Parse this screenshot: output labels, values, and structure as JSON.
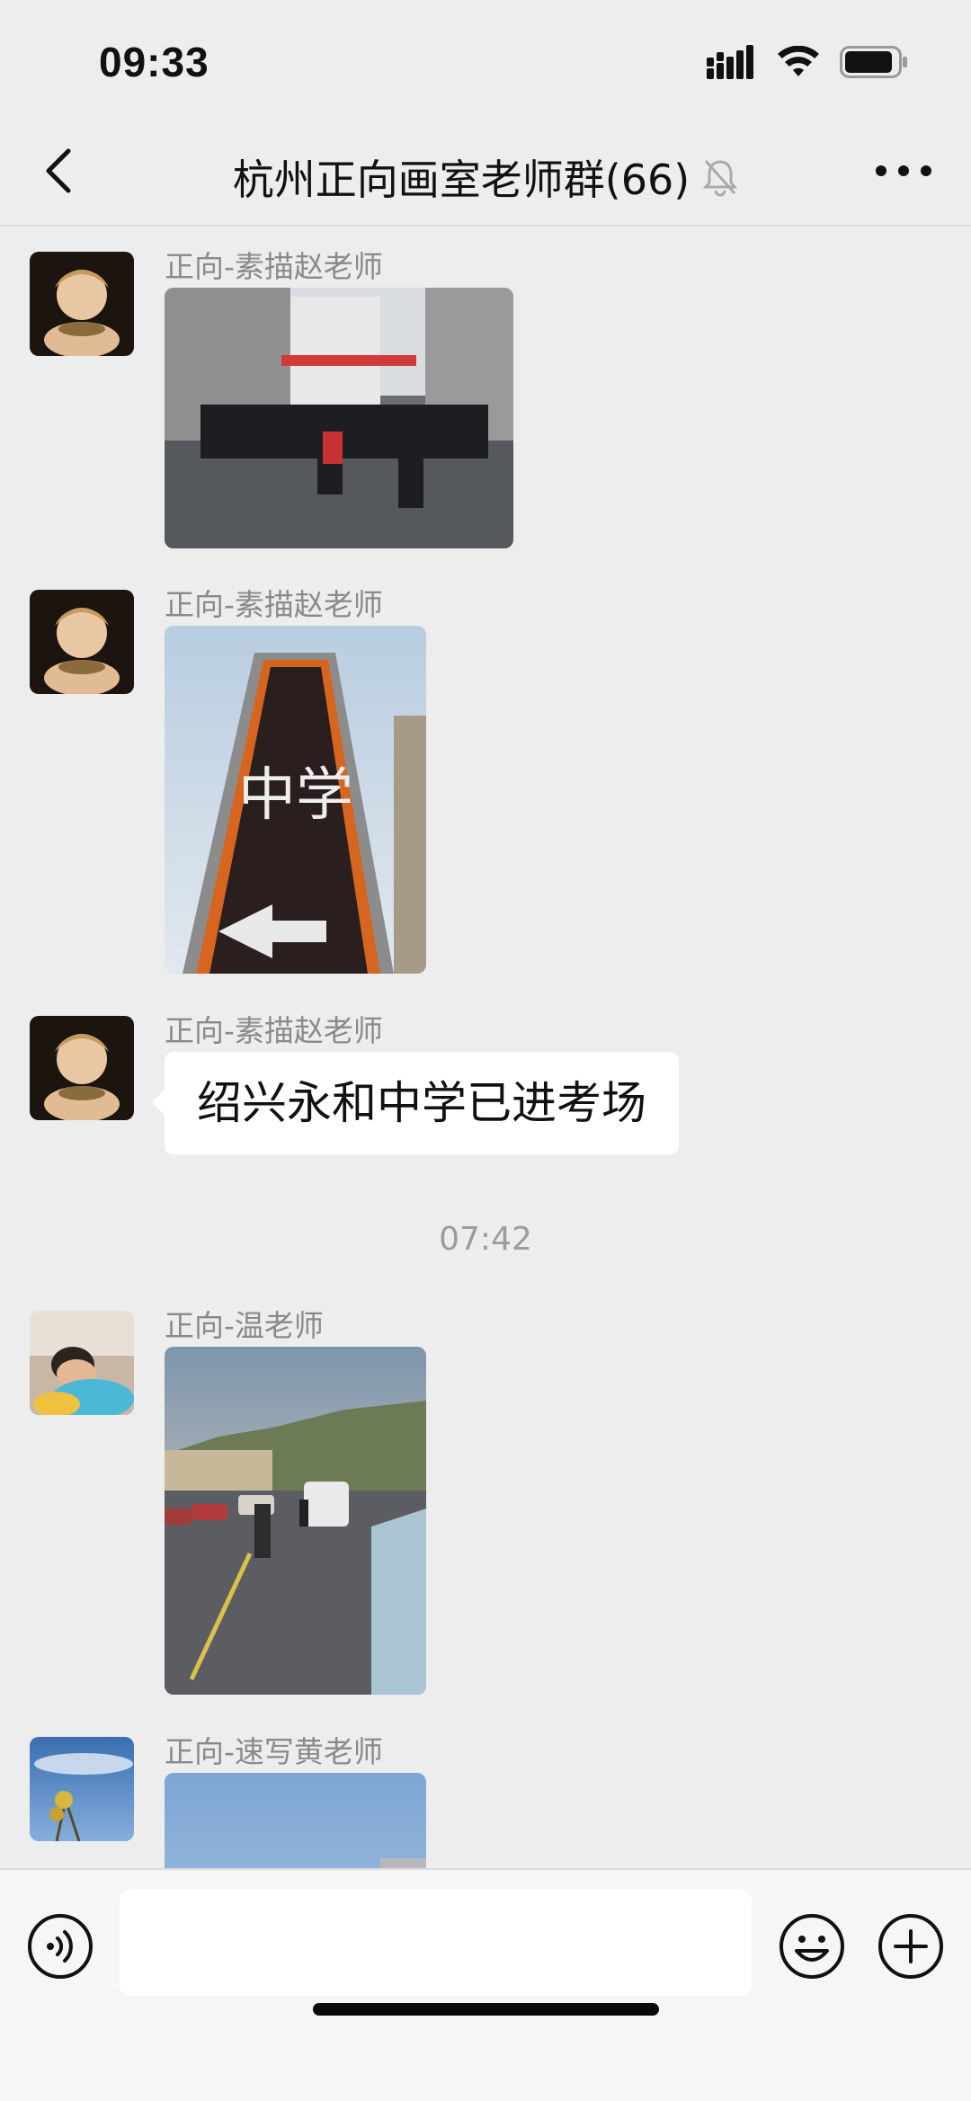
{
  "status": {
    "time": "09:33"
  },
  "nav": {
    "title": "杭州正向画室老师群(66)"
  },
  "messages": [
    {
      "sender": "正向-素描赵老师",
      "kind": "image",
      "image_desc": "street-crowd-photo"
    },
    {
      "sender": "正向-素描赵老师",
      "kind": "image",
      "image_desc": "school-sign-photo",
      "sign_text": "中学"
    },
    {
      "sender": "正向-素描赵老师",
      "kind": "text",
      "text": "绍兴永和中学已进考场"
    },
    {
      "sender": "正向-温老师",
      "kind": "image",
      "image_desc": "road-parking-photo"
    },
    {
      "sender": "正向-速写黄老师",
      "kind": "image",
      "image_desc": "sky-photo"
    }
  ],
  "timestamp": "07:42",
  "input": {
    "placeholder": ""
  },
  "colors": {
    "background": "#ededed",
    "bubble": "#ffffff",
    "sender": "#8a8a8a"
  },
  "icons": [
    "back-icon",
    "mute-bell-icon",
    "more-icon",
    "voice-icon",
    "emoji-icon",
    "plus-icon"
  ]
}
